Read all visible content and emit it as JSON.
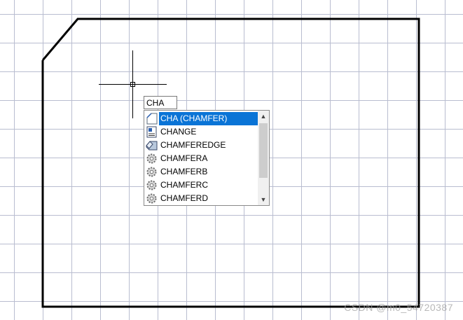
{
  "command_line": {
    "typed_text": "CHA"
  },
  "autocomplete": {
    "items": [
      {
        "label": "CHA (CHAMFER)",
        "icon": "chamfer-icon",
        "selected": true
      },
      {
        "label": "CHANGE",
        "icon": "properties-icon",
        "selected": false
      },
      {
        "label": "CHAMFEREDGE",
        "icon": "chamfer-edge-icon",
        "selected": false
      },
      {
        "label": "CHAMFERA",
        "icon": "gear-icon",
        "selected": false
      },
      {
        "label": "CHAMFERB",
        "icon": "gear-icon",
        "selected": false
      },
      {
        "label": "CHAMFERC",
        "icon": "gear-icon",
        "selected": false
      },
      {
        "label": "CHAMFERD",
        "icon": "gear-icon",
        "selected": false
      }
    ]
  },
  "watermark": "CSDN @m0_54720387",
  "colors": {
    "grid": "#b9bdd0",
    "selection": "#0a74d6",
    "outline": "#000000"
  }
}
